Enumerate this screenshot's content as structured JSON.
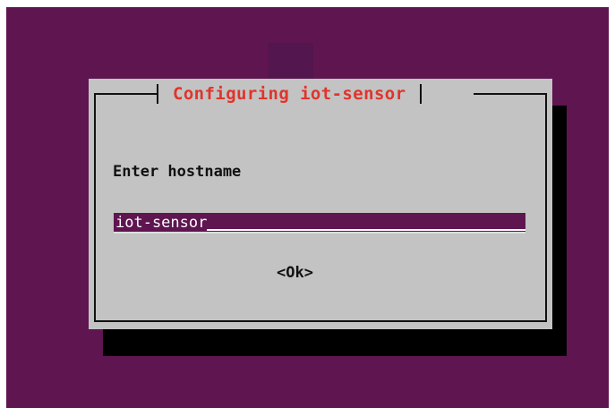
{
  "dialog": {
    "title": "Configuring iot-sensor",
    "prompt": "Enter hostname",
    "hostname_value": "iot-sensor",
    "ok_label": "<Ok>"
  },
  "colors": {
    "background": "#5e1550",
    "dialog": "#c3c3c3",
    "title": "#e0342b",
    "shadow": "#000000"
  }
}
